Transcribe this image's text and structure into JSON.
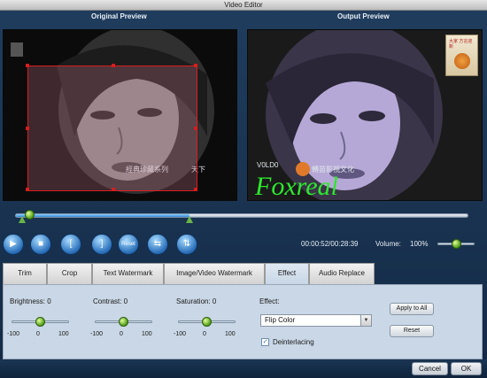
{
  "window": {
    "title": "Video Editor"
  },
  "previews": {
    "original_label": "Original Preview",
    "output_label": "Output Preview",
    "original_caption": "經典珍藏系列",
    "original_corner": "天下",
    "output_caption_left": "V0LD0",
    "output_caption_mid": "轉苗影視文化",
    "watermark_text": "Foxreal",
    "logo_text": "大家 方言迎新",
    "colors": {
      "crop_rect": "#d61e1e",
      "watermark": "#2ee82e",
      "output_tint": "#b6a8d6"
    }
  },
  "timeline": {
    "progress": 0.385
  },
  "controls": {
    "buttons": [
      {
        "name": "play-button",
        "glyph": "▶"
      },
      {
        "name": "stop-button",
        "glyph": "■"
      },
      {
        "name": "mark-in-button",
        "glyph": "["
      },
      {
        "name": "mark-out-button",
        "glyph": "]"
      },
      {
        "name": "reset-playback-button",
        "glyph": "Reset"
      },
      {
        "name": "flip-horizontal-button",
        "glyph": "⇆"
      },
      {
        "name": "flip-vertical-button",
        "glyph": "⇅"
      }
    ],
    "time_readout": "00:00:52/00:28:39",
    "volume_label": "Volume:",
    "volume_value": "100%",
    "volume_level": 1.0
  },
  "tabs": [
    {
      "label": "Trim",
      "active": false
    },
    {
      "label": "Crop",
      "active": false
    },
    {
      "label": "Text Watermark",
      "active": false
    },
    {
      "label": "Image/Video Watermark",
      "active": false
    },
    {
      "label": "Effect",
      "active": true
    },
    {
      "label": "Audio Replace",
      "active": false
    }
  ],
  "effect_panel": {
    "brightness_label": "Brightness: 0",
    "contrast_label": "Contrast: 0",
    "saturation_label": "Saturation: 0",
    "scale_min": "-100",
    "scale_mid": "0",
    "scale_max": "100",
    "effect_label": "Effect:",
    "effect_selected": "Flip Color",
    "deinterlacing_label": "Deinterlacing",
    "deinterlacing_checked": true,
    "apply_to_all_label": "Apply to All",
    "reset_label": "Reset"
  },
  "footer": {
    "cancel_label": "Cancel",
    "ok_label": "OK"
  }
}
